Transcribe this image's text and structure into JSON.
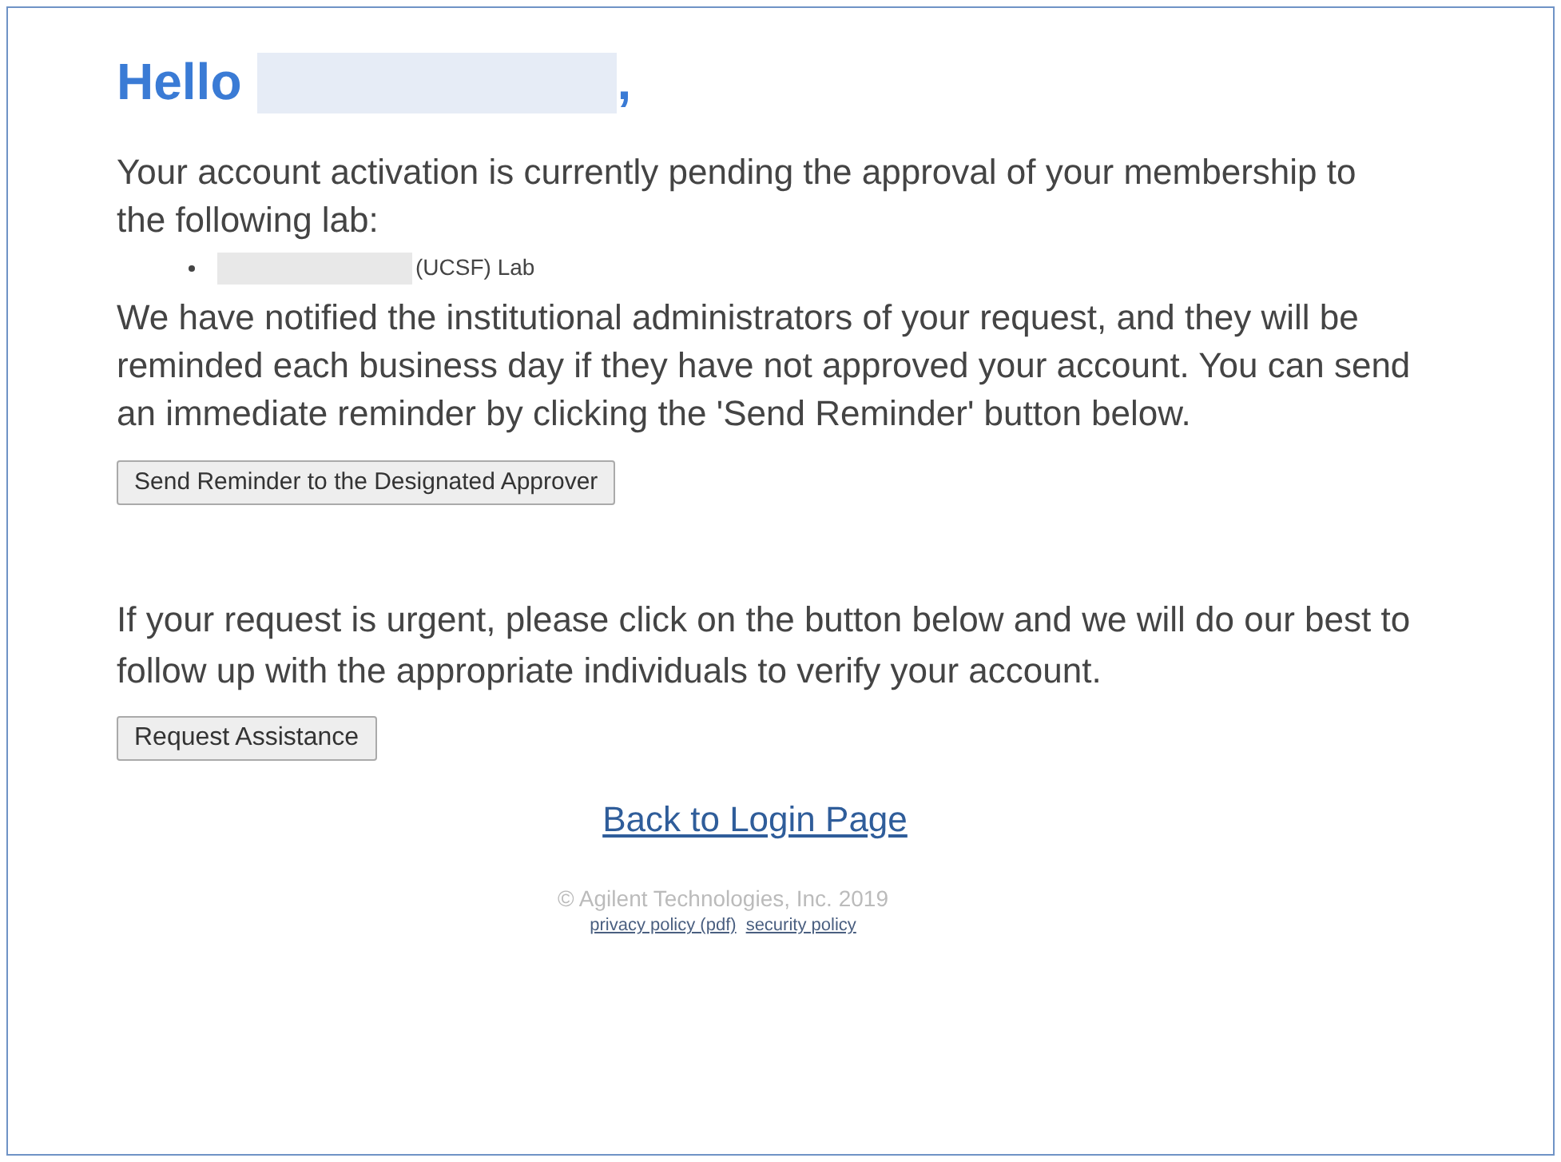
{
  "greeting": {
    "hello": "Hello",
    "comma": ","
  },
  "intro": "Your account activation is currently pending the approval of your membership to the following lab:",
  "labs": [
    {
      "name": "(UCSF) Lab"
    }
  ],
  "notice": "We have notified the institutional administrators of your request, and they will be reminded each business day if they have not approved your account. You can send an immediate reminder by clicking the 'Send Reminder' button below.",
  "reminder_button": "Send Reminder to the Designated Approver",
  "urgent": "If your request is urgent, please click on the button below and we will do our best to follow up with the appropriate individuals to verify your account.",
  "assistance_button": "Request Assistance",
  "back_link": "Back to Login Page",
  "footer": {
    "copyright": "© Agilent Technologies, Inc. 2019",
    "links": [
      "privacy policy (pdf)",
      "security policy"
    ]
  }
}
